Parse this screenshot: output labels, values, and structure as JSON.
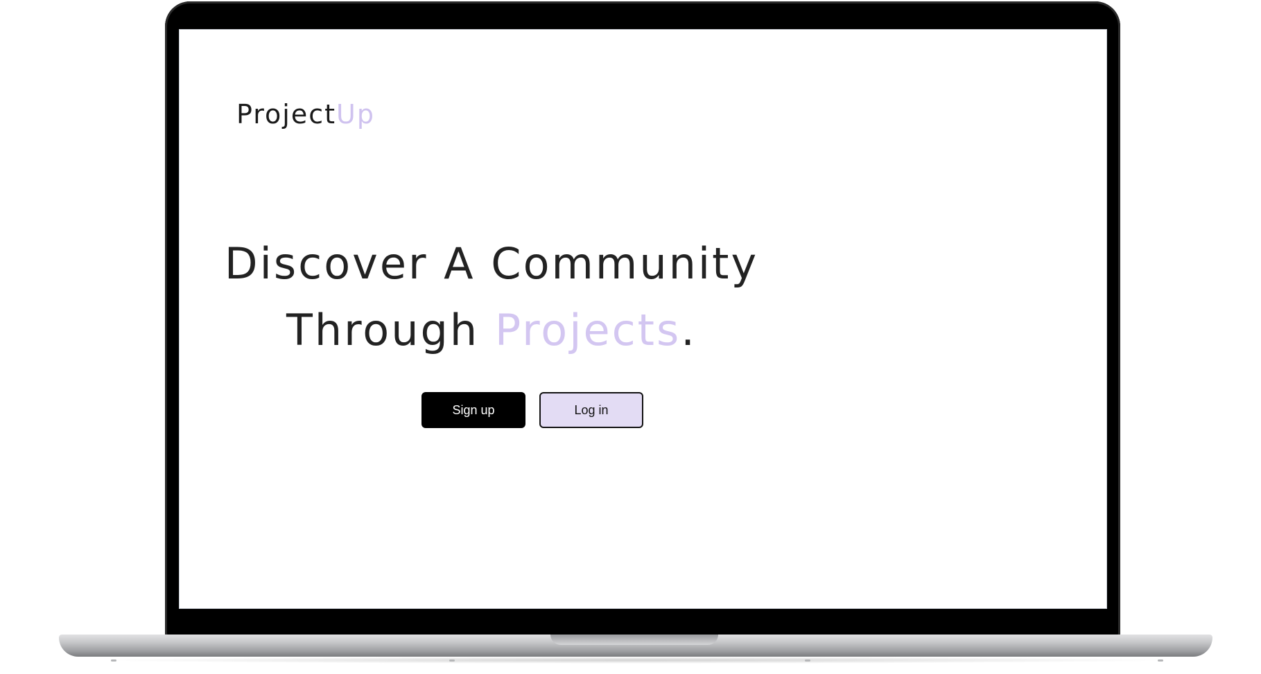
{
  "brand": {
    "name_main": "Project",
    "name_accent": "Up",
    "accent_color": "#cfc2ef"
  },
  "hero": {
    "line1": "Discover A Community",
    "line2_prefix": "Through ",
    "line2_accent": "Projects",
    "line2_suffix": "."
  },
  "actions": {
    "signup_label": "Sign up",
    "login_label": "Log in",
    "signup_color": "#000000",
    "login_color": "#e3dcf4"
  },
  "device": {
    "frame": "laptop-mockup"
  }
}
